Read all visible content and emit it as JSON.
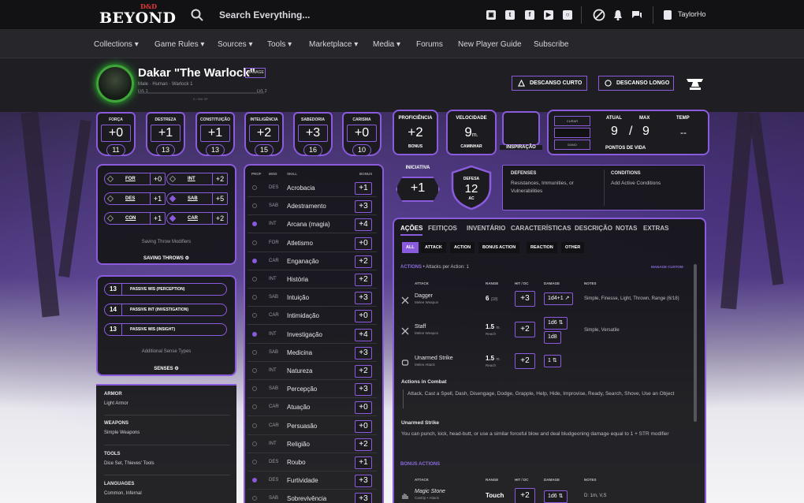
{
  "header": {
    "logo_small": "D&D",
    "logo_big": "BEYOND",
    "search_placeholder": "Search Everything...",
    "username": "TaylorHo"
  },
  "nav": [
    "Collections ▾",
    "Game Rules ▾",
    "Sources ▾",
    "Tools ▾",
    "Marketplace ▾",
    "Media ▾",
    "Forums",
    "New Player Guide",
    "Subscribe"
  ],
  "character": {
    "name": "Dakar \"The Warlock\"",
    "manage": "MANAGE",
    "subtitle": "Male · Human · Warlock 1",
    "xp_left": "LVL 1",
    "xp_right": "LVL 2",
    "xp_center": "0 / 300 XP",
    "short_rest": "DESCANSO CURTO",
    "long_rest": "DESCANSO LONGO"
  },
  "abilities": [
    {
      "label": "FORÇA",
      "mod": "+0",
      "score": "11"
    },
    {
      "label": "DESTREZA",
      "mod": "+1",
      "score": "13"
    },
    {
      "label": "CONSTITUIÇÃO",
      "mod": "+1",
      "score": "13"
    },
    {
      "label": "INTELIGÊNCIA",
      "mod": "+2",
      "score": "15"
    },
    {
      "label": "SABEDORIA",
      "mod": "+3",
      "score": "16"
    },
    {
      "label": "CARISMA",
      "mod": "+0",
      "score": "10"
    }
  ],
  "proficiency": {
    "label": "PROFICIÊNCIA",
    "value": "+2",
    "sub": "BONUS"
  },
  "speed": {
    "label": "VELOCIDADE",
    "value": "9",
    "unit": "m.",
    "sub": "CAMINHAR"
  },
  "inspiration_label": "INSPIRAÇÃO",
  "hp": {
    "heal_label": "CURAR",
    "damage_label": "DANO",
    "current_label": "ATUAL",
    "max_label": "MAX",
    "temp_label": "TEMP",
    "current": "9",
    "sep": "/",
    "max": "9",
    "temp": "--",
    "title": "PONTOS DE VIDA"
  },
  "saving_throws": {
    "rows": [
      {
        "ab": "FOR",
        "v": "+0",
        "on": false
      },
      {
        "ab": "INT",
        "v": "+2",
        "on": false
      },
      {
        "ab": "DES",
        "v": "+1",
        "on": false
      },
      {
        "ab": "SAB",
        "v": "+5",
        "on": true
      },
      {
        "ab": "CON",
        "v": "+1",
        "on": false
      },
      {
        "ab": "CAR",
        "v": "+2",
        "on": true
      }
    ],
    "caption": "Saving Throw Modifiers",
    "title": "SAVING THROWS"
  },
  "senses": {
    "rows": [
      {
        "num": "13",
        "label": "PASSIVE WIS (PERCEPTION)"
      },
      {
        "num": "14",
        "label": "PASSIVE INT (INVESTIGATION)"
      },
      {
        "num": "13",
        "label": "PASSIVE WIS (INSIGHT)"
      }
    ],
    "caption": "Additional Sense Types",
    "title": "SENSES"
  },
  "proficiencies": [
    {
      "h": "ARMOR",
      "t": "Light Armor"
    },
    {
      "h": "WEAPONS",
      "t": "Simple Weapons"
    },
    {
      "h": "TOOLS",
      "t": "Dice Set, Thieves' Tools"
    },
    {
      "h": "LANGUAGES",
      "t": "Common, Infernal"
    }
  ],
  "skills_header": {
    "prof": "PROF",
    "mod": "MOD",
    "skill": "SKILL",
    "bonus": "BONUS"
  },
  "skills": [
    {
      "ab": "DES",
      "name": "Acrobacia",
      "bonus": "+1",
      "p": false
    },
    {
      "ab": "SAB",
      "name": "Adestramento",
      "bonus": "+3",
      "p": false
    },
    {
      "ab": "INT",
      "name": "Arcana (magia)",
      "bonus": "+4",
      "p": true
    },
    {
      "ab": "FOR",
      "name": "Atletismo",
      "bonus": "+0",
      "p": false
    },
    {
      "ab": "CAR",
      "name": "Enganação",
      "bonus": "+2",
      "p": true
    },
    {
      "ab": "INT",
      "name": "História",
      "bonus": "+2",
      "p": false
    },
    {
      "ab": "SAB",
      "name": "Intuição",
      "bonus": "+3",
      "p": false
    },
    {
      "ab": "CAR",
      "name": "Intimidação",
      "bonus": "+0",
      "p": false
    },
    {
      "ab": "INT",
      "name": "Investigação",
      "bonus": "+4",
      "p": true
    },
    {
      "ab": "SAB",
      "name": "Medicina",
      "bonus": "+3",
      "p": false
    },
    {
      "ab": "INT",
      "name": "Natureza",
      "bonus": "+2",
      "p": false
    },
    {
      "ab": "SAB",
      "name": "Percepção",
      "bonus": "+3",
      "p": false
    },
    {
      "ab": "CAR",
      "name": "Atuação",
      "bonus": "+0",
      "p": false
    },
    {
      "ab": "CAR",
      "name": "Persuasão",
      "bonus": "+0",
      "p": false
    },
    {
      "ab": "INT",
      "name": "Religião",
      "bonus": "+2",
      "p": false
    },
    {
      "ab": "DES",
      "name": "Roubo",
      "bonus": "+1",
      "p": false
    },
    {
      "ab": "DES",
      "name": "Furtividade",
      "bonus": "+3",
      "p": true
    },
    {
      "ab": "SAB",
      "name": "Sobrevivência",
      "bonus": "+3",
      "p": false
    }
  ],
  "initiative": {
    "label": "INICIATIVA",
    "value": "+1"
  },
  "defense": {
    "label": "DEFESA",
    "value": "12",
    "sub": "AC"
  },
  "defenses_panel": {
    "h1": "DEFENSES",
    "t1": "Resistances, Immunities, or Vulnerabilities",
    "h2": "CONDITIONS",
    "t2": "Add Active Conditions"
  },
  "tabs": [
    "AÇÕES",
    "FEITIÇOS",
    "INVENTÁRIO",
    "CARACTERÍSTICAS",
    "DESCRIÇÃO",
    "NOTAS",
    "EXTRAS"
  ],
  "filters": [
    "ALL",
    "ATTACK",
    "ACTION",
    "BONUS ACTION",
    "REACTION",
    "OTHER"
  ],
  "actions": {
    "section_title": "ACTIONS",
    "per_action": "• Attacks per Action: 1",
    "manage_custom": "MANAGE CUSTOM",
    "col_attack": "ATTACK",
    "col_range": "RANGE",
    "col_hit": "HIT / DC",
    "col_damage": "DAMAGE",
    "col_notes": "NOTES",
    "attacks": [
      {
        "name": "Dagger",
        "sub": "Melee Weapon",
        "range": "6",
        "range_unit": "(18)",
        "range_sub": "",
        "hit": "+3",
        "dmg": [
          "1d4+1 ↗"
        ],
        "notes": "Simple, Finesse, Light, Thrown, Range (6/18)"
      },
      {
        "name": "Staff",
        "sub": "Melee Weapon",
        "range": "1.5",
        "range_unit": "m.",
        "range_sub": "Reach",
        "hit": "+2",
        "dmg": [
          "1d6 ⇅",
          "1d8"
        ],
        "notes": "Simple, Versatile"
      },
      {
        "name": "Unarmed Strike",
        "sub": "Melee Attack",
        "range": "1.5",
        "range_unit": "m.",
        "range_sub": "Reach",
        "hit": "+2",
        "dmg": [
          "1 ⇅"
        ],
        "notes": ""
      }
    ],
    "combat_title": "Actions in Combat",
    "combat_text": "Attack, Cast a Spell, Dash, Disengage, Dodge, Grapple, Help, Hide, Improvise, Ready, Search, Shove, Use an Object",
    "unarmed_title": "Unarmed Strike",
    "unarmed_text": "You can punch, kick, head-butt, or use a similar forceful blow and deal bludgeoning damage equal to 1 + STR modifier",
    "bonus_title": "BONUS ACTIONS",
    "bonus_attack": {
      "name": "Magic Stone",
      "sub": "Cantrip • Attack",
      "range": "Touch",
      "hit": "+2",
      "dmg": "1d6 ⇅",
      "notes": "D: 1m, V,S"
    }
  },
  "colors": {
    "accent": "#8a5bdc",
    "bg": "#1e1e22",
    "panel": "#16161a"
  }
}
